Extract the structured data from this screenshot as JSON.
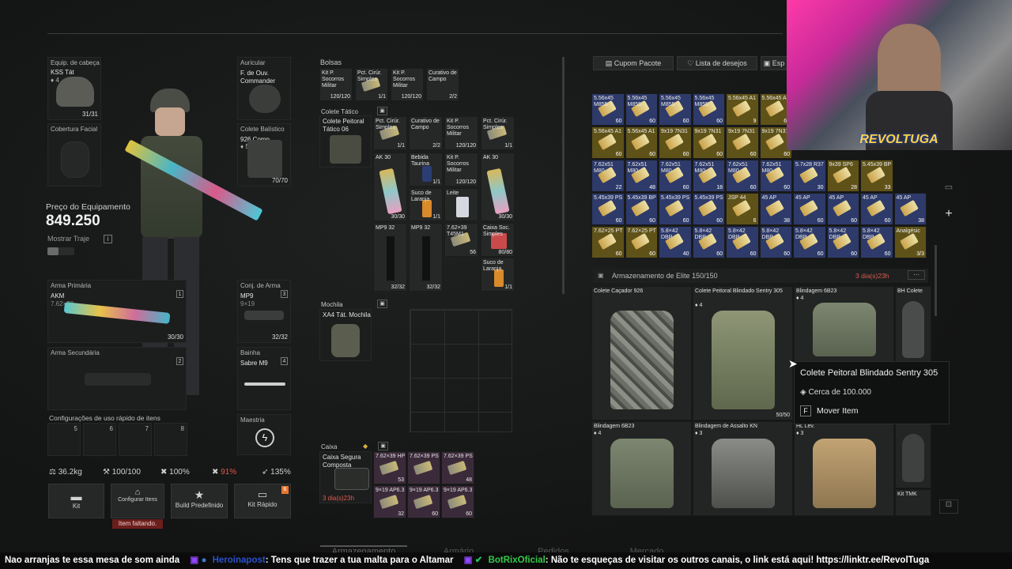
{
  "equipment": {
    "head_label": "Equip. de cabeça",
    "head_item": "KSS Tát",
    "head_stars": "4",
    "head_dur": "31/31",
    "face_label": "Cobertura Facial",
    "ear_label": "Auricular",
    "ear_item": "F. de Ouv. Commander",
    "vest_label": "Colete Balístico",
    "vest_item": "926 Comp.",
    "vest_stars": "5",
    "vest_dur": "70/70",
    "price_label": "Preço do Equipamento",
    "price_value": "849.250",
    "show_outfit": "Mostrar Traje",
    "primary_label": "Arma Primária",
    "primary_item": "AKM",
    "primary_ammo": "7.62×39",
    "primary_slot": "1",
    "primary_count": "30/30",
    "secondary_label": "Arma Secundária",
    "secondary_slot": "2",
    "pistol_label": "Conj. de Arma",
    "pistol_item": "MP9",
    "pistol_ammo": "9×19",
    "pistol_slot": "3",
    "pistol_count": "32/32",
    "melee_label": "Bainha",
    "melee_item": "Sabre M9",
    "melee_slot": "4",
    "quick_label": "Configurações de uso rápido de itens",
    "quick_slots": [
      "5",
      "6",
      "7",
      "8"
    ],
    "mastery_label": "Maestria"
  },
  "stats": {
    "weight": "36.2kg",
    "durability": "100/100",
    "repair": "100%",
    "hydration": "91%",
    "energy": "135%"
  },
  "actions": {
    "kit": "Kit",
    "configure": "Configurar Itens",
    "missing": "Item faltando.",
    "build": "Build Predefinido",
    "quick_kit": "Kit Rápido",
    "badge": "6"
  },
  "bags": {
    "header": "Bolsas",
    "items": [
      {
        "name": "Kit P. Socorros Militar",
        "count": "120/120"
      },
      {
        "name": "Pct. Cirúr. Simples",
        "count": "1/1"
      },
      {
        "name": "Kit P. Socorros Militar",
        "count": "120/120"
      },
      {
        "name": "Curativo de Campo",
        "count": "2/2"
      }
    ]
  },
  "rig": {
    "header": "Colete Tático",
    "item": "Colete Peitoral Tático 06",
    "cells": [
      {
        "name": "Pct. Cirúr. Simples",
        "count": "1/1"
      },
      {
        "name": "Curativo de Campo",
        "count": "2/2"
      },
      {
        "name": "Kit P. Socorros Militar",
        "count": "120/120"
      },
      {
        "name": "Pct. Cirúr. Simples",
        "count": "1/1"
      },
      {
        "name": "AK 30",
        "count": "30/30"
      },
      {
        "name": "Bebida Taurina",
        "count": "1/1"
      },
      {
        "name": "Kit P. Socorros Militar",
        "count": "120/120"
      },
      {
        "name": "AK 30",
        "count": "30/30"
      },
      {
        "name": "Suco de Laranja",
        "count": "1/1"
      },
      {
        "name": "Leite",
        "count": ""
      },
      {
        "name": "MP9 32",
        "count": "32/32"
      },
      {
        "name": "MP9 32",
        "count": "32/32"
      },
      {
        "name": "7.62×39 T45M1",
        "count": "56"
      },
      {
        "name": "Caixa Soc. Simples",
        "count": "80/80"
      },
      {
        "name": "Suco de Laranja",
        "count": "1/1"
      }
    ]
  },
  "backpack": {
    "header": "Mochila",
    "item": "XA4 Tát. Mochila"
  },
  "box": {
    "header": "Caixa",
    "item": "Caixa Segura Composta",
    "timer": "3 dia(s)23h",
    "cells": [
      {
        "name": "7.62×39 HP",
        "count": "53"
      },
      {
        "name": "7.62×39 PS",
        "count": ""
      },
      {
        "name": "7.62×39 PS",
        "count": "48"
      },
      {
        "name": "9×19 AP6.3",
        "count": "32"
      },
      {
        "name": "9×19 AP6.3",
        "count": "60"
      },
      {
        "name": "9×19 AP6.3",
        "count": "60"
      }
    ]
  },
  "store": {
    "buttons": [
      "Cupom Pacote",
      "Lista de desejos",
      "Esp"
    ],
    "ammo_rows": [
      [
        {
          "n": "5.56x45 M855",
          "c": "60",
          "k": "b"
        },
        {
          "n": "5.56x45 M855",
          "c": "60",
          "k": "b"
        },
        {
          "n": "5.56x45 M855",
          "c": "60",
          "k": "b"
        },
        {
          "n": "5.56x45 M855",
          "c": "60",
          "k": "b"
        },
        {
          "n": "5.56x45 A1",
          "c": "9",
          "k": "y"
        },
        {
          "n": "5.56x45 A1",
          "c": "60",
          "k": "y"
        }
      ],
      [
        {
          "n": "5.56x45 A1",
          "c": "60",
          "k": "y"
        },
        {
          "n": "5.56x45 A1",
          "c": "60",
          "k": "y"
        },
        {
          "n": "9x19 7N31",
          "c": "60",
          "k": "y"
        },
        {
          "n": "9x19 7N31",
          "c": "60",
          "k": "y"
        },
        {
          "n": "9x19 7N31",
          "c": "60",
          "k": "y"
        },
        {
          "n": "9x19 7N31",
          "c": "60",
          "k": "y"
        }
      ],
      [
        {
          "n": "7.62x51 M80",
          "c": "22",
          "k": "b"
        },
        {
          "n": "7.62x51 M80",
          "c": "48",
          "k": "b"
        },
        {
          "n": "7.62x51 M80",
          "c": "60",
          "k": "b"
        },
        {
          "n": "7.62x51 M80",
          "c": "18",
          "k": "b"
        },
        {
          "n": "7.62x51 M80",
          "c": "60",
          "k": "b"
        },
        {
          "n": "7.62x51 M80",
          "c": "60",
          "k": "b"
        },
        {
          "n": "5.7x28 R37",
          "c": "30",
          "k": "b"
        },
        {
          "n": "9x39 SP6",
          "c": "28",
          "k": "y"
        },
        {
          "n": "5.45x39 BP",
          "c": "33",
          "k": "y"
        }
      ],
      [
        {
          "n": "5.45x39 PS",
          "c": "60",
          "k": "b"
        },
        {
          "n": "5.45x39 BP",
          "c": "60",
          "k": "b"
        },
        {
          "n": "5.45x39 PS",
          "c": "60",
          "k": "b"
        },
        {
          "n": "5.45x39 PS",
          "c": "60",
          "k": "b"
        },
        {
          "n": "JSP 44",
          "c": "6",
          "k": "y"
        },
        {
          "n": "45 AP",
          "c": "38",
          "k": "b"
        },
        {
          "n": "45 AP",
          "c": "60",
          "k": "b"
        },
        {
          "n": "45 AP",
          "c": "60",
          "k": "b"
        },
        {
          "n": "45 AP",
          "c": "60",
          "k": "b"
        },
        {
          "n": "45 AP",
          "c": "38",
          "k": "b"
        }
      ],
      [
        {
          "n": "7.62×25 PT",
          "c": "60",
          "k": "y"
        },
        {
          "n": "7.62×25 PT",
          "c": "60",
          "k": "y"
        },
        {
          "n": "5.8×42 DBP",
          "c": "40",
          "k": "b"
        },
        {
          "n": "5.8×42 DBP",
          "c": "60",
          "k": "b"
        },
        {
          "n": "5.8×42 DBP",
          "c": "60",
          "k": "b"
        },
        {
          "n": "5.8×42 DBP",
          "c": "60",
          "k": "b"
        },
        {
          "n": "5.8×42 DBP",
          "c": "60",
          "k": "b"
        },
        {
          "n": "5.8×42 DBP",
          "c": "60",
          "k": "b"
        },
        {
          "n": "5.8×42 DBP",
          "c": "60",
          "k": "b"
        },
        {
          "n": "Analgésic",
          "c": "3/3",
          "k": "y"
        }
      ]
    ],
    "elite_header": "Armazenamento de Elite",
    "elite_count": "150/150",
    "elite_timer": "3 dia(s)23h",
    "vests": [
      {
        "name": "Colete Caçador 926",
        "stars": "",
        "dur": ""
      },
      {
        "name": "Colete Peitoral Blindado Sentry 305",
        "stars": "4",
        "dur": "50/50"
      },
      {
        "name": "Blindagem 6B23",
        "stars": "4",
        "dur": ""
      },
      {
        "name": "BH Colete",
        "stars": "",
        "dur": ""
      },
      {
        "name": "Blindagem 6B23",
        "stars": "4",
        "dur": ""
      },
      {
        "name": "Blindagem de Assalto KN",
        "stars": "3",
        "dur": ""
      },
      {
        "name": "HL Lev.",
        "stars": "3",
        "dur": ""
      },
      {
        "name": "Kit TMK",
        "stars": "",
        "dur": ""
      }
    ]
  },
  "tooltip": {
    "title": "Colete Peitoral Blindado Sentry 305",
    "price": "Cerca de 100.000",
    "key": "F",
    "action": "Mover Item"
  },
  "bottom_tabs": [
    "Armazenamento",
    "Armário",
    "Pedidos",
    "Mercado"
  ],
  "stream": {
    "logo": "REVOLTUGA"
  },
  "ticker": {
    "msg1": "Nao arranjas te essa mesa de som ainda",
    "user1": "Heroinapost",
    "msg2": ": Tens que trazer a tua malta para o Altamar",
    "user2": "BotRixOficial",
    "msg3": ": Não te esqueças de visitar os outros canais, o link está aqui! https://linktr.ee/RevolTuga"
  },
  "colors": {
    "ammo_blue": "#2d3a6a",
    "ammo_yellow": "#5f5218",
    "accent_red": "#e05a4a",
    "accent_green": "#22c55e",
    "bot_green": "#35c94a"
  }
}
